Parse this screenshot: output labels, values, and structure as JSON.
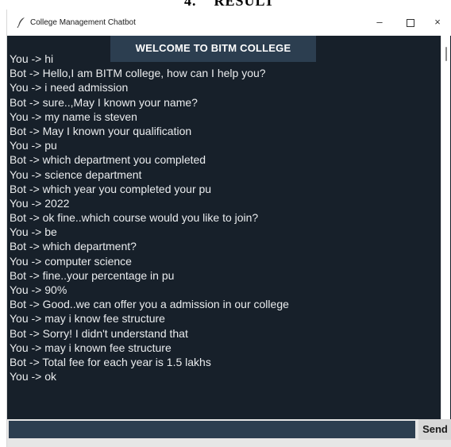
{
  "page_heading_fragment": "4.    RESULT",
  "window": {
    "title": "College Management Chatbot",
    "icon": "feather-icon",
    "controls": {
      "minimize": "–",
      "maximize": "maximize-icon",
      "close": "×"
    }
  },
  "header": {
    "label": "WELCOME TO BITM COLLEGE"
  },
  "messages": [
    "You -> hi",
    "Bot -> Hello,I am BITM college, how can I help you?",
    "You -> i need admission",
    "Bot -> sure..,May I known your name?",
    "You -> my name is steven",
    "Bot -> May I known your qualification",
    "You -> pu",
    "Bot -> which department you completed",
    "You -> science department",
    "Bot -> which year you completed your pu",
    "You -> 2022",
    "Bot -> ok fine..which course would you like to join?",
    "You -> be",
    "Bot -> which department?",
    "You -> computer science",
    "Bot -> fine..your percentage in pu",
    "You -> 90%",
    "Bot -> Good..we can offer you a admission in our college",
    "You -> may i know fee structure",
    "Bot -> Sorry! I didn't understand that",
    "You -> may i known fee structure",
    "Bot -> Total fee for each year is 1.5 lakhs",
    "You -> ok"
  ],
  "input": {
    "value": "",
    "placeholder": ""
  },
  "send_button": {
    "label": "Send"
  },
  "colors": {
    "chat_background": "#17202a",
    "header_background": "#2c3e50",
    "text": "#eaecee",
    "input_background": "#2c3e50"
  }
}
